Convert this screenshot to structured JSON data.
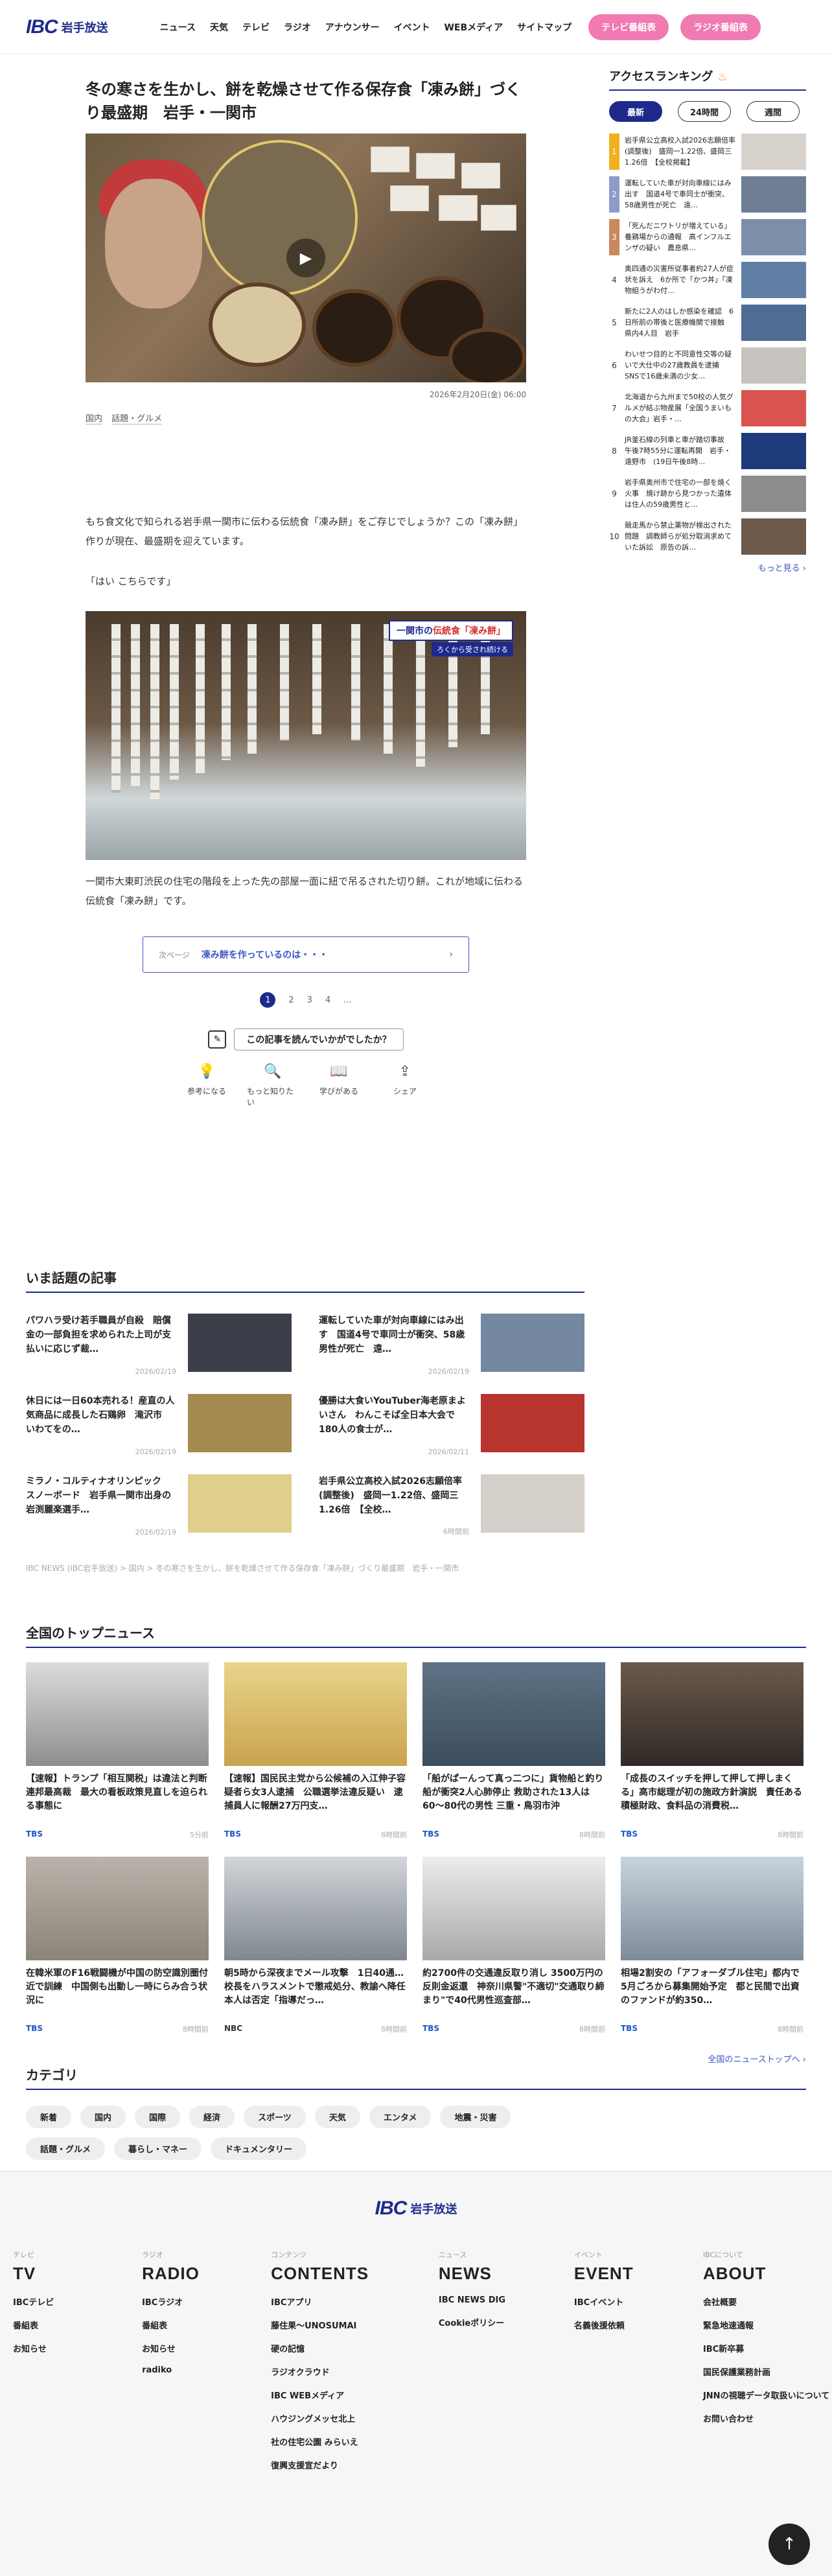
{
  "header": {
    "logo_mark": "IBC",
    "logo_text": "岩手放送",
    "nav": [
      "ニュース",
      "天気",
      "テレビ",
      "ラジオ",
      "アナウンサー",
      "イベント",
      "WEBメディア",
      "サイトマップ"
    ],
    "tv_schedule": "テレビ番組表",
    "radio_schedule": "ラジオ番組表"
  },
  "article": {
    "title": "冬の寒さを生かし、餅を乾燥させて作る保存食「凍み餅」づくり最盛期　岩手・一関市",
    "date": "2026年2月20日(金) 06:00",
    "tags": [
      "国内",
      "話題・グルメ"
    ],
    "lead": "もち食文化で知られる岩手県一関市に伝わる伝統食「凍み餅」をご存じでしょうか？この「凍み餅」作りが現在、最盛期を迎えています。",
    "quote": "「はい こちらです」",
    "photo_badge_prefix": "一関市の",
    "photo_badge_highlight": "伝統食「凍み餅」",
    "photo_badge_sub": "ろくから受され続ける",
    "photo_caption": "一関市大東町渋民の住宅の階段を上った先の部屋一面に紐で吊るされた切り餅。これが地域に伝わる伝統食「凍み餅」です。",
    "next_label": "次ページ",
    "next_title": "凍み餅を作っているのは・・・",
    "pages": [
      "1",
      "2",
      "3",
      "4",
      "..."
    ],
    "feedback_q": "この記事を読んでいかがでしたか？",
    "reactions": [
      {
        "icon": "bulb-icon",
        "label": "参考になる"
      },
      {
        "icon": "magnifier-icon",
        "label": "もっと知りたい"
      },
      {
        "icon": "book-icon",
        "label": "学びがある"
      },
      {
        "icon": "share-icon",
        "label": "シェア"
      }
    ]
  },
  "sidebar": {
    "title": "アクセスランキング",
    "tabs": [
      "最新",
      "24時間",
      "週間"
    ],
    "items": [
      {
        "n": "1",
        "text": "岩手県公立高校入試2026志願倍率(調整後)　盛岡一1.22倍、盛岡三1.26倍　【全校掲載】"
      },
      {
        "n": "2",
        "text": "運転していた車が対向車線にはみ出す　国道4号で車同士が衝突、58歳男性が死亡　遠…"
      },
      {
        "n": "3",
        "text": "「死んだニワトリが増えている」養鶏場からの通報　高インフルエンザの疑い　農息県…"
      },
      {
        "n": "4",
        "text": "奥四通の災害所従事者約27人が症状を訴え　6か所で「かつ丼」「凍物組うがわ付…"
      },
      {
        "n": "5",
        "text": "新たに2人のはしか感染を確認　6日所前の帯後と医療機関で接触　県内4人目　岩手"
      },
      {
        "n": "6",
        "text": "わいせつ目的と不同意性交等の疑いで大仕中の27歳教員を逮捕　SNSで16歳未満の少女…"
      },
      {
        "n": "7",
        "text": "北海道から九州まで50校の人気グルメが結ぶ物産展「全国うまいもの大会」岩手・…"
      },
      {
        "n": "8",
        "text": "JR釜石線の列車と車が踏切事故　午後7時55分に運転再開　岩手・遠野市　(19日午後8時…"
      },
      {
        "n": "9",
        "text": "岩手県奥州市で住宅の一部を焼く火事　焼け跡から見つかった遺体は住人の59歳男性と…"
      },
      {
        "n": "10",
        "text": "競走馬から禁止薬物が検出された問題　調教師らが処分取消求めていた訴訟　原告の訴…"
      }
    ],
    "more": "もっと見る ›"
  },
  "topics": {
    "title": "いま話題の記事",
    "items": [
      {
        "title": "パワハラ受け若手職員が自殺　賠償金の一部負担を求められた上司が支払いに応じず裁…",
        "date": "2026/02/19"
      },
      {
        "title": "運転していた車が対向車線にはみ出す　国道4号で車同士が衝突、58歳男性が死亡　遠…",
        "date": "2026/02/19"
      },
      {
        "title": "休日には一日60本売れる！産直の人気商品に成長した石鶏卵　滝沢市　いわてをの…",
        "date": "2026/02/19"
      },
      {
        "title": "優勝は大食いYouTuber海老原まよいさん　わんこそば全日本大会で180人の食士が…",
        "date": "2026/02/11"
      },
      {
        "title": "ミラノ・コルティナオリンピック　スノーボード　岩手県一関市出身の岩渕麗楽選手…",
        "date": "2026/02/19"
      },
      {
        "title": "岩手県公立高校入試2026志願倍率(調整後)　盛岡一1.22倍、盛岡三1.26倍　【全校…",
        "date": "6時間前"
      }
    ]
  },
  "breadcrumb": "IBC NEWS (IBC岩手放送) > 国内 > 冬の寒さを生かし、餅を乾燥させて作る保存食「凍み餅」づくり最盛期　岩手・一関市",
  "top_news": {
    "title": "全国のトップニュース",
    "items": [
      {
        "title": "【速報】トランプ「相互関税」は違法と判断　連邦最高裁　最大の看板政策見直しを迫られる事態に",
        "src": "TBS",
        "time": "5分前"
      },
      {
        "title": "【速報】国民民主党から公候補の入江伸子容疑者ら女3人逮捕　公職選挙法違反疑い　逮捕員人に報酬27万円支…",
        "src": "TBS",
        "time": "8時間前"
      },
      {
        "title": "「船がぱーんって真っ二つに」貨物船と釣り船が衝突2人心肺停止 救助された13人は60〜80代の男性 三重・鳥羽市沖",
        "src": "TBS",
        "time": "8時間前"
      },
      {
        "title": "「成長のスイッチを押して押して押しまくる」高市総理が初の施政方針演説　責任ある積極財政、食料品の消費税…",
        "src": "TBS",
        "time": "8時間前"
      },
      {
        "title": "在韓米軍のF16戦闘機が中国の防空識別圏付近で訓練　中国側も出動し一時にらみ合う状況に",
        "src": "TBS",
        "time": "8時間前"
      },
      {
        "title": "朝5時から深夜までメール攻撃　1日40通…校長をハラスメントで懲戒処分、教諭へ降任　本人は否定「指導だっ…",
        "src": "NBC",
        "time": "8時間前"
      },
      {
        "title": "約2700件の交通違反取り消し 3500万円の反則金返還　神奈川県警\"不適切\"交通取り締まり\"で40代男性巡査部…",
        "src": "TBS",
        "time": "8時間前"
      },
      {
        "title": "相場2割安の「アフォーダブル住宅」都内で5月ごろから募集開始予定　都と民間で出資のファンドが約350…",
        "src": "TBS",
        "time": "8時間前"
      }
    ],
    "all_link": "全国のニューストップへ ›"
  },
  "categories": {
    "title": "カテゴリ",
    "items": [
      "新着",
      "国内",
      "国際",
      "経済",
      "スポーツ",
      "天気",
      "エンタメ",
      "地震・災害",
      "話題・グルメ",
      "暮らし・マネー",
      "ドキュメンタリー"
    ]
  },
  "footer": {
    "cols": [
      {
        "cap": "テレビ",
        "head": "TV",
        "links": [
          "IBCテレビ",
          "番組表",
          "お知らせ"
        ]
      },
      {
        "cap": "ラジオ",
        "head": "RADIO",
        "links": [
          "IBCラジオ",
          "番組表",
          "お知らせ",
          "radiko"
        ]
      },
      {
        "cap": "コンテンツ",
        "head": "CONTENTS",
        "links": [
          "IBCアプリ",
          "藤住果〜UNOSUMAI",
          "硬の記憶",
          "ラジオクラウド",
          "IBC WEBメディア",
          "ハウジングメッセ北上",
          "社の住宅公園 みらいえ",
          "復興支援宣だより"
        ]
      },
      {
        "cap": "ニュース",
        "head": "NEWS",
        "links": [
          "IBC NEWS DIG",
          "Cookieポリシー"
        ]
      },
      {
        "cap": "イベント",
        "head": "EVENT",
        "links": [
          "IBCイベント",
          "名義後援依頼"
        ]
      },
      {
        "cap": "IBCについて",
        "head": "ABOUT",
        "links": [
          "会社概要",
          "緊急地速通報",
          "IBC新卒募",
          "国民保護業務計画",
          "JNNの視聴データ取扱いについて",
          "お問い合わせ"
        ]
      }
    ]
  },
  "to_top": "↑"
}
